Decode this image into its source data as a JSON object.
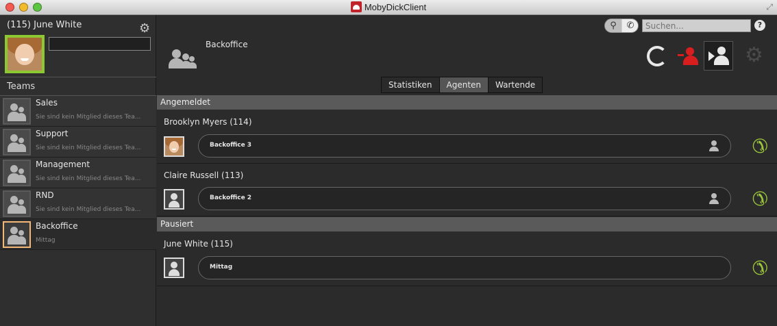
{
  "window": {
    "title": "MobyDickClient"
  },
  "user": {
    "name": "(115) June White",
    "status_value": ""
  },
  "sidebar": {
    "teams_header": "Teams",
    "teams": [
      {
        "name": "Sales",
        "subtitle": "Sie sind kein Mitglied dieses Tea..."
      },
      {
        "name": "Support",
        "subtitle": "Sie sind kein Mitglied dieses Tea..."
      },
      {
        "name": "Management",
        "subtitle": "Sie sind kein Mitglied dieses Tea..."
      },
      {
        "name": "RND",
        "subtitle": "Sie sind kein Mitglied dieses Tea..."
      },
      {
        "name": "Backoffice",
        "subtitle": "Mittag",
        "selected": true
      }
    ]
  },
  "main": {
    "team_title": "Backoffice",
    "search": {
      "placeholder": "Suchen...",
      "value": ""
    },
    "help": "?",
    "tabs": [
      {
        "label": "Statistiken"
      },
      {
        "label": "Agenten",
        "selected": true
      },
      {
        "label": "Wartende"
      }
    ],
    "sections": {
      "logged_in": "Angemeldet",
      "paused": "Pausiert"
    },
    "agents_logged_in": [
      {
        "name": "Brooklyn Myers (114)",
        "line": "Backoffice 3",
        "avatar": "photo"
      },
      {
        "name": "Claire Russell (113)",
        "line": "Backoffice 2",
        "avatar": "generic"
      }
    ],
    "agents_paused": [
      {
        "name": "June White (115)",
        "line": "Mittag",
        "avatar": "generic"
      }
    ]
  },
  "icons": {
    "settings": "gear-icon",
    "search": "magnifier-icon",
    "phone": "phone-icon",
    "refresh": "refresh-icon",
    "logout_agent": "red-person-minus-icon",
    "login_agent": "person-arrow-icon",
    "call": "green-phone-icon"
  },
  "colors": {
    "accent_green": "#9ac43a",
    "avatar_frame": "#8bc832",
    "selected_team_frame": "#f4b978",
    "logout_red": "#d81e1e"
  }
}
